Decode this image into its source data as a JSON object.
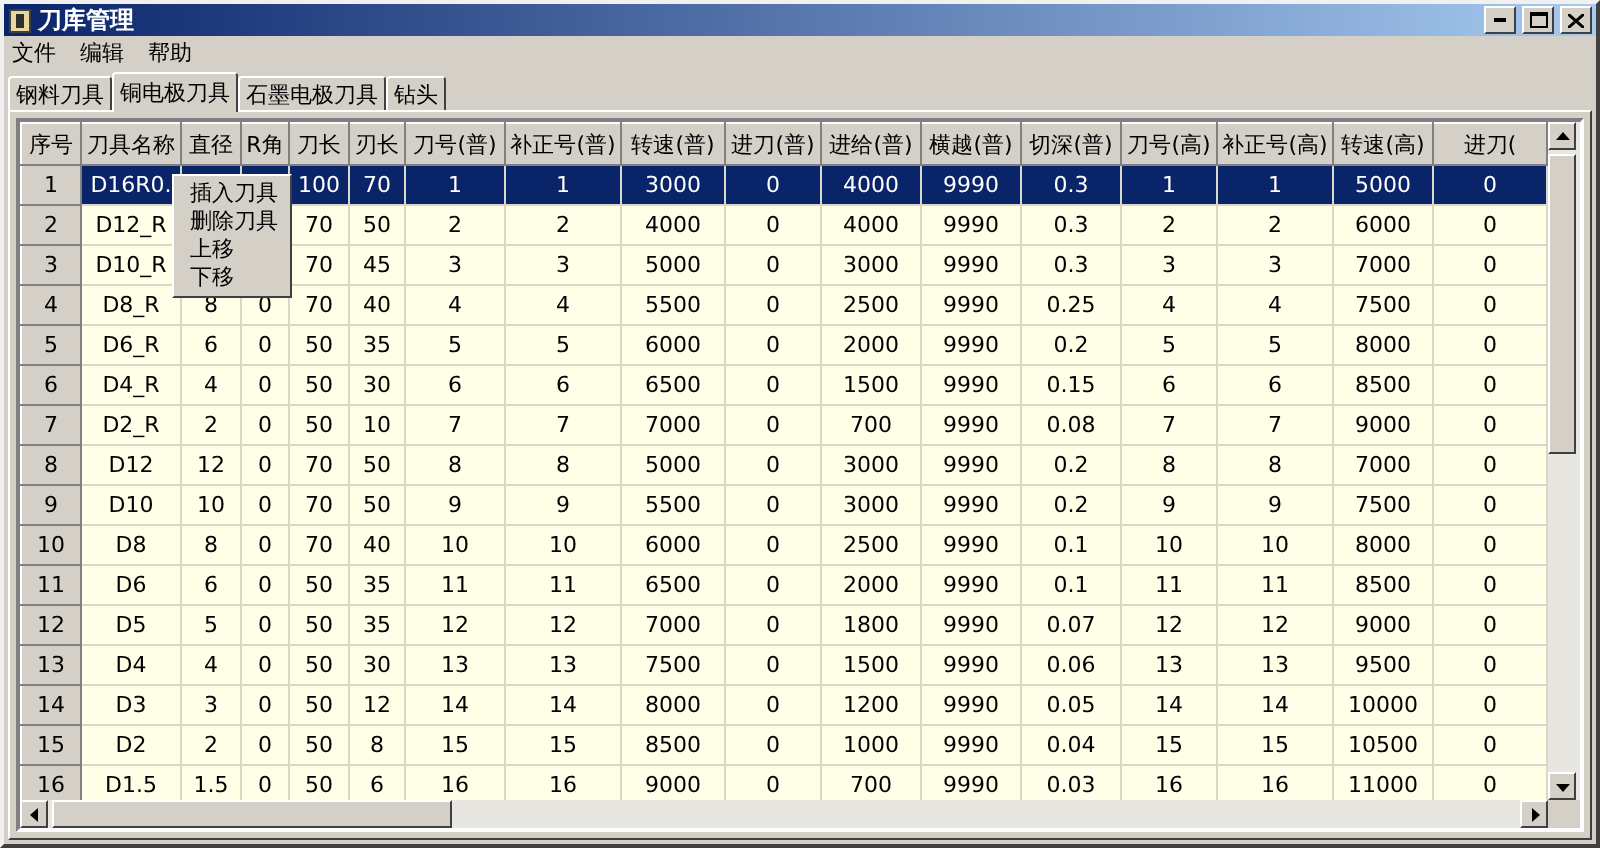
{
  "window": {
    "title": "刀库管理"
  },
  "menu_bar": [
    "文件",
    "编辑",
    "帮助"
  ],
  "tabs": [
    {
      "label": "钢料刀具",
      "selected": false
    },
    {
      "label": "铜电极刀具",
      "selected": true
    },
    {
      "label": "石墨电极刀具",
      "selected": false
    },
    {
      "label": "钻头",
      "selected": false
    }
  ],
  "table": {
    "columns": [
      "序号",
      "刀具名称",
      "直径",
      "R角",
      "刀长",
      "刃长",
      "刀号(普)",
      "补正号(普)",
      "转速(普)",
      "进刀(普)",
      "进给(普)",
      "横越(普)",
      "切深(普)",
      "刀号(高)",
      "补正号(高)",
      "转速(高)",
      "进刀("
    ],
    "rows": [
      {
        "selected": true,
        "cells": [
          "1",
          "D16R0.",
          null,
          null,
          "100",
          "70",
          "1",
          "1",
          "3000",
          "0",
          "4000",
          "9990",
          "0.3",
          "1",
          "1",
          "5000",
          "0"
        ]
      },
      {
        "selected": false,
        "cells": [
          "2",
          "D12_R",
          null,
          null,
          "70",
          "50",
          "2",
          "2",
          "4000",
          "0",
          "4000",
          "9990",
          "0.3",
          "2",
          "2",
          "6000",
          "0"
        ]
      },
      {
        "selected": false,
        "cells": [
          "3",
          "D10_R",
          null,
          null,
          "70",
          "45",
          "3",
          "3",
          "5000",
          "0",
          "3000",
          "9990",
          "0.3",
          "3",
          "3",
          "7000",
          "0"
        ]
      },
      {
        "selected": false,
        "cells": [
          "4",
          "D8_R",
          "8",
          "0",
          "70",
          "40",
          "4",
          "4",
          "5500",
          "0",
          "2500",
          "9990",
          "0.25",
          "4",
          "4",
          "7500",
          "0"
        ]
      },
      {
        "selected": false,
        "cells": [
          "5",
          "D6_R",
          "6",
          "0",
          "50",
          "35",
          "5",
          "5",
          "6000",
          "0",
          "2000",
          "9990",
          "0.2",
          "5",
          "5",
          "8000",
          "0"
        ]
      },
      {
        "selected": false,
        "cells": [
          "6",
          "D4_R",
          "4",
          "0",
          "50",
          "30",
          "6",
          "6",
          "6500",
          "0",
          "1500",
          "9990",
          "0.15",
          "6",
          "6",
          "8500",
          "0"
        ]
      },
      {
        "selected": false,
        "cells": [
          "7",
          "D2_R",
          "2",
          "0",
          "50",
          "10",
          "7",
          "7",
          "7000",
          "0",
          "700",
          "9990",
          "0.08",
          "7",
          "7",
          "9000",
          "0"
        ]
      },
      {
        "selected": false,
        "cells": [
          "8",
          "D12",
          "12",
          "0",
          "70",
          "50",
          "8",
          "8",
          "5000",
          "0",
          "3000",
          "9990",
          "0.2",
          "8",
          "8",
          "7000",
          "0"
        ]
      },
      {
        "selected": false,
        "cells": [
          "9",
          "D10",
          "10",
          "0",
          "70",
          "50",
          "9",
          "9",
          "5500",
          "0",
          "3000",
          "9990",
          "0.2",
          "9",
          "9",
          "7500",
          "0"
        ]
      },
      {
        "selected": false,
        "cells": [
          "10",
          "D8",
          "8",
          "0",
          "70",
          "40",
          "10",
          "10",
          "6000",
          "0",
          "2500",
          "9990",
          "0.1",
          "10",
          "10",
          "8000",
          "0"
        ]
      },
      {
        "selected": false,
        "cells": [
          "11",
          "D6",
          "6",
          "0",
          "50",
          "35",
          "11",
          "11",
          "6500",
          "0",
          "2000",
          "9990",
          "0.1",
          "11",
          "11",
          "8500",
          "0"
        ]
      },
      {
        "selected": false,
        "cells": [
          "12",
          "D5",
          "5",
          "0",
          "50",
          "35",
          "12",
          "12",
          "7000",
          "0",
          "1800",
          "9990",
          "0.07",
          "12",
          "12",
          "9000",
          "0"
        ]
      },
      {
        "selected": false,
        "cells": [
          "13",
          "D4",
          "4",
          "0",
          "50",
          "30",
          "13",
          "13",
          "7500",
          "0",
          "1500",
          "9990",
          "0.06",
          "13",
          "13",
          "9500",
          "0"
        ]
      },
      {
        "selected": false,
        "cells": [
          "14",
          "D3",
          "3",
          "0",
          "50",
          "12",
          "14",
          "14",
          "8000",
          "0",
          "1200",
          "9990",
          "0.05",
          "14",
          "14",
          "10000",
          "0"
        ]
      },
      {
        "selected": false,
        "cells": [
          "15",
          "D2",
          "2",
          "0",
          "50",
          "8",
          "15",
          "15",
          "8500",
          "0",
          "1000",
          "9990",
          "0.04",
          "15",
          "15",
          "10500",
          "0"
        ]
      },
      {
        "selected": false,
        "cells": [
          "16",
          "D1.5",
          "1.5",
          "0",
          "50",
          "6",
          "16",
          "16",
          "9000",
          "0",
          "700",
          "9990",
          "0.03",
          "16",
          "16",
          "11000",
          "0"
        ]
      }
    ]
  },
  "context_menu": [
    "插入刀具",
    "删除刀具",
    "上移",
    "下移"
  ]
}
